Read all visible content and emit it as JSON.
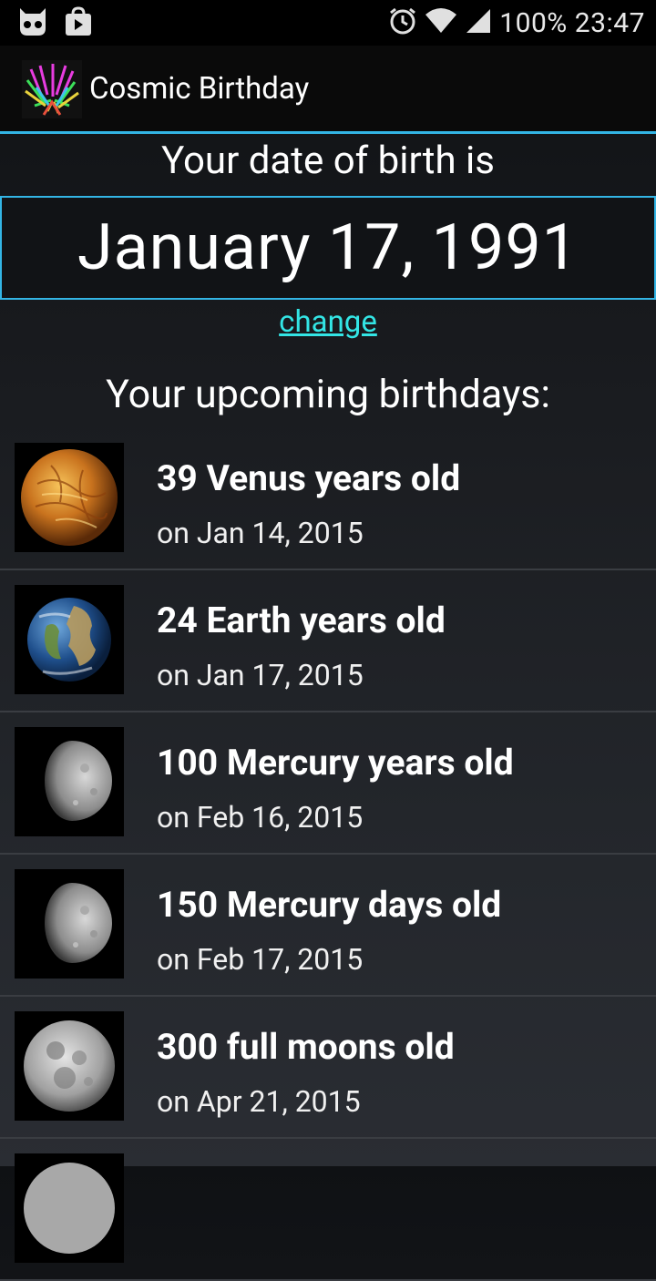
{
  "status_bar": {
    "battery": "100%",
    "time": "23:47"
  },
  "app": {
    "title": "Cosmic Birthday"
  },
  "dob": {
    "heading": "Your date of birth is",
    "value": "January 17, 1991",
    "change_label": "change"
  },
  "upcoming": {
    "heading": "Your upcoming birthdays:",
    "items": [
      {
        "title": "39 Venus years old",
        "date": "on Jan 14, 2015",
        "icon": "venus-icon"
      },
      {
        "title": "24 Earth years old",
        "date": "on Jan 17, 2015",
        "icon": "earth-icon"
      },
      {
        "title": "100 Mercury years old",
        "date": "on Feb 16, 2015",
        "icon": "mercury-icon"
      },
      {
        "title": "150 Mercury days old",
        "date": "on Feb 17, 2015",
        "icon": "mercury-icon"
      },
      {
        "title": "300 full moons old",
        "date": "on Apr 21, 2015",
        "icon": "moon-icon"
      }
    ]
  },
  "colors": {
    "accent": "#33b5e5",
    "link": "#33e5e5"
  }
}
